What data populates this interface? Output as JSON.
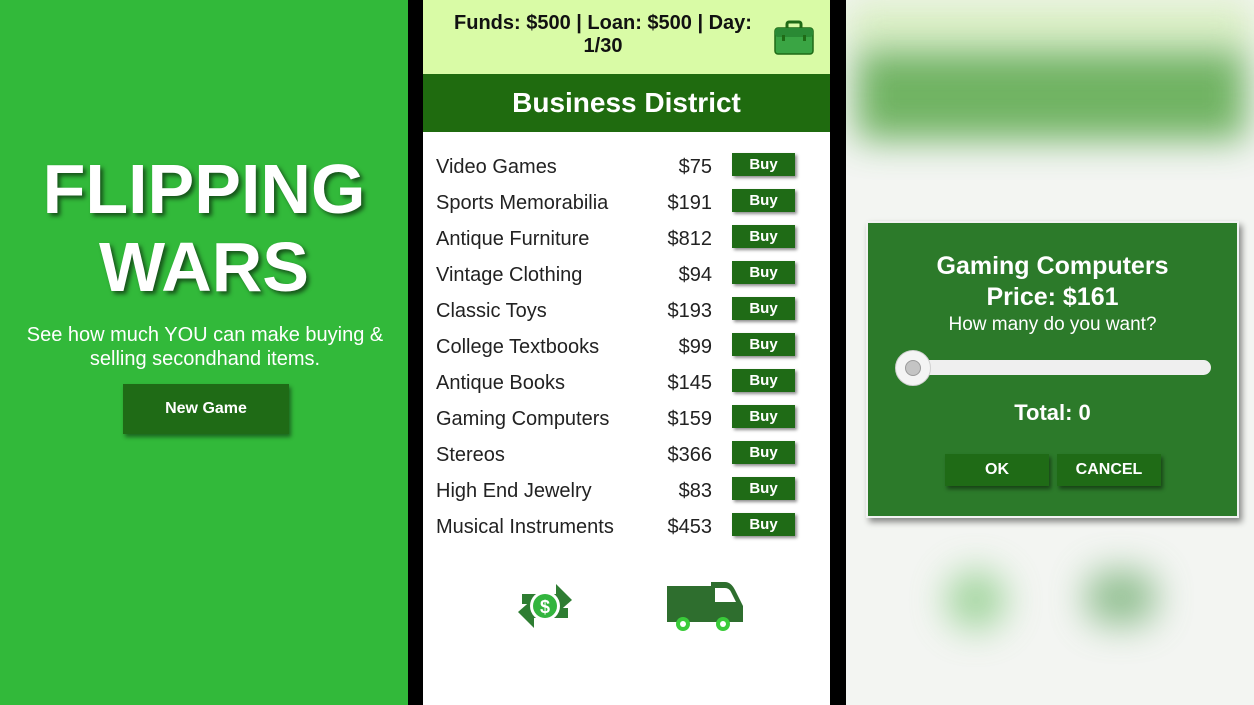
{
  "title_screen": {
    "title_line1": "FLIPPING",
    "title_line2": "WARS",
    "tagline": "See how much YOU can make buying & selling secondhand items.",
    "new_game_label": "New Game"
  },
  "market": {
    "status_text": "Funds: $500 | Loan: $500 | Day: 1/30",
    "district": "Business District",
    "buy_label": "Buy",
    "items": [
      {
        "name": "Video Games",
        "price": "$75"
      },
      {
        "name": "Sports Memorabilia",
        "price": "$191"
      },
      {
        "name": "Antique Furniture",
        "price": "$812"
      },
      {
        "name": "Vintage Clothing",
        "price": "$94"
      },
      {
        "name": "Classic Toys",
        "price": "$193"
      },
      {
        "name": "College Textbooks",
        "price": "$99"
      },
      {
        "name": "Antique Books",
        "price": "$145"
      },
      {
        "name": "Gaming Computers",
        "price": "$159"
      },
      {
        "name": "Stereos",
        "price": "$366"
      },
      {
        "name": "High End Jewelry",
        "price": "$83"
      },
      {
        "name": "Musical Instruments",
        "price": "$453"
      }
    ],
    "icons": {
      "briefcase": "briefcase-icon",
      "exchange": "money-exchange-icon",
      "van": "delivery-van-icon"
    }
  },
  "dialog": {
    "item_name": "Gaming Computers",
    "price_label": "Price: $161",
    "question": "How many do you want?",
    "quantity_fraction": 0,
    "total_label": "Total: 0",
    "ok_label": "OK",
    "cancel_label": "CANCEL"
  },
  "colors": {
    "title_bg": "#32b93a",
    "button_green": "#1f6b16",
    "status_bar": "#d9fba6",
    "district_header": "#1f6b0f",
    "dialog_bg": "#2c7a2a"
  }
}
